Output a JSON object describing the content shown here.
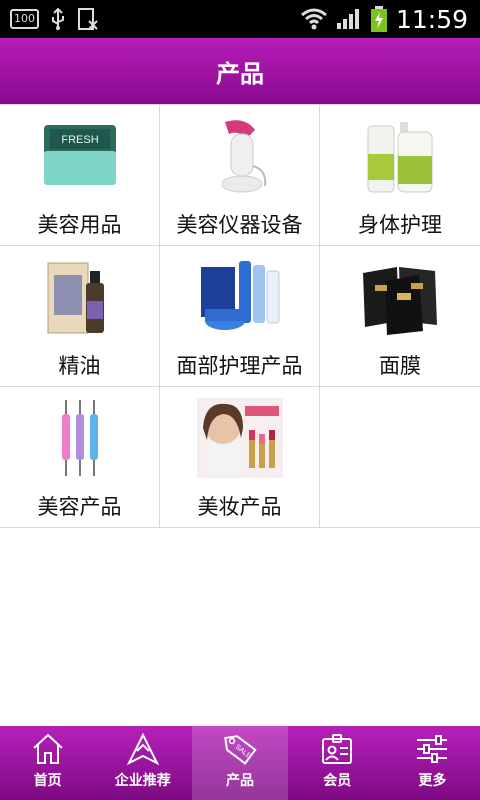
{
  "status_bar": {
    "time": "11:59",
    "battery_badge": "100"
  },
  "header": {
    "title": "产品"
  },
  "categories": [
    {
      "label": "美容用品",
      "icon": "face-cream-jar-icon"
    },
    {
      "label": "美容仪器设备",
      "icon": "facial-steamer-icon"
    },
    {
      "label": "身体护理",
      "icon": "lotion-bottles-icon"
    },
    {
      "label": "精油",
      "icon": "essential-oil-icon"
    },
    {
      "label": "面部护理产品",
      "icon": "skincare-set-icon"
    },
    {
      "label": "面膜",
      "icon": "face-mask-packs-icon"
    },
    {
      "label": "美容产品",
      "icon": "nail-dotting-tools-icon"
    },
    {
      "label": "美妆产品",
      "icon": "lipstick-ad-icon"
    }
  ],
  "bottom_nav": [
    {
      "label": "首页",
      "icon": "home-icon",
      "active": false
    },
    {
      "label": "企业推荐",
      "icon": "recommend-icon",
      "active": false
    },
    {
      "label": "产品",
      "icon": "tag-sale-icon",
      "active": true
    },
    {
      "label": "会员",
      "icon": "member-card-icon",
      "active": false
    },
    {
      "label": "更多",
      "icon": "settings-sliders-icon",
      "active": false
    }
  ],
  "colors": {
    "accent": "#9e14a2",
    "status_bar": "#000000"
  }
}
